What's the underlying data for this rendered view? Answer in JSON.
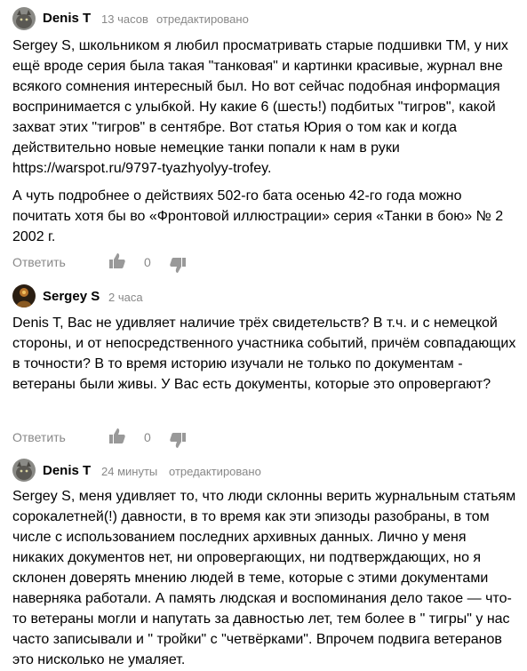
{
  "comments": [
    {
      "author": "Denis T",
      "time": "13 часов",
      "edited": "отредактировано",
      "paragraphs": [
        "Sergey S, школьником я любил просматривать старые подшивки ТМ, у них ещё вроде серия была такая \"танковая\" и картинки красивые, журнал вне всякого сомнения интересный был. Но вот сейчас подобная информация воспринимается с улыбкой. Ну какие 6 (шесть!) подбитых \"тигров\", какой захват этих \"тигров\" в сентябре. Вот статья Юрия о том как и когда действительно новые немецкие танки попали к нам в руки https://warspot.ru/9797-tyazhyolyy-trofey.",
        "А чуть подробнее о действиях 502-го бата осенью 42-го года можно почитать хотя бы во «Фронтовой иллюстрации» серия «Танки в бою» № 2 2002 г."
      ],
      "reply": "Ответить",
      "likes": "0",
      "avatar_icon": "cat-avatar"
    },
    {
      "author": "Sergey S",
      "time": "2 часа",
      "edited": "",
      "paragraphs": [
        "Denis T, Вас не удивляет наличие трёх свидетельств? В т.ч. и с немецкой стороны, и от непосредственного участника событий, причём совпадающих в точности? В то время историю изучали не только по документам - ветераны были живы. У Вас есть документы, которые это опровергают?"
      ],
      "reply": "Ответить",
      "likes": "0",
      "avatar_icon": "dark-figure-avatar"
    },
    {
      "author": "Denis T",
      "time": "24 минуты",
      "edited": "отредактировано",
      "paragraphs": [
        "Sergey S, меня удивляет то, что люди склонны верить журнальным статьям сорокалетней(!) давности, в то время как эти эпизоды разобраны, в том числе с использованием последних архивных данных. Лично у меня никаких документов нет, ни опровергающих, ни подтверждающих, но я склонен доверять мнению людей в теме, которые с этими документами наверняка работали. А память людская и воспоминания дело такое — что-то ветераны могли и напутать за давностью лет, тем более в \" тигры\" у нас часто записывали и \" тройки\" с \"четвёрками\". Впрочем подвига ветеранов это нисколько не умаляет."
      ],
      "avatar_icon": "cat-avatar"
    }
  ],
  "icons": {
    "like": "thumbs-up-icon",
    "dislike": "thumbs-down-icon"
  },
  "colors": {
    "muted": "#888888",
    "icon": "#999999"
  }
}
